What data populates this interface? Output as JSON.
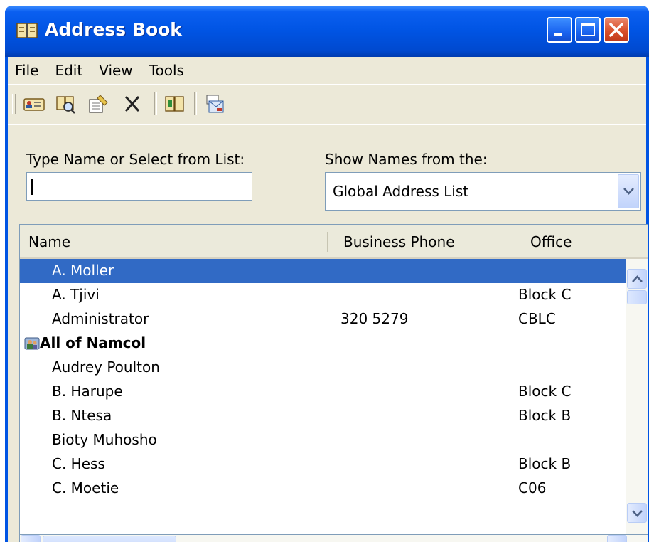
{
  "window": {
    "title": "Address Book",
    "icon": "address-book-icon",
    "controls": {
      "minimize": "minimize-icon",
      "maximize": "maximize-icon",
      "close": "close-icon"
    }
  },
  "menu": [
    "File",
    "Edit",
    "View",
    "Tools"
  ],
  "toolbar": {
    "buttons": [
      "new-entry-icon",
      "find-people-icon",
      "properties-icon",
      "delete-icon",
      "add-to-contacts-icon",
      "new-message-icon"
    ]
  },
  "search": {
    "label": "Type Name or Select from List:",
    "value": ""
  },
  "source": {
    "label": "Show Names from the:",
    "selected": "Global Address List"
  },
  "list": {
    "columns": [
      "Name",
      "Business Phone",
      "Office"
    ],
    "rows": [
      {
        "name": "A. Moller",
        "phone": "",
        "office": "",
        "selected": true
      },
      {
        "name": "A. Tjivi",
        "phone": "",
        "office": "Block C"
      },
      {
        "name": "Administrator",
        "phone": "320 5279",
        "office": "CBLC"
      },
      {
        "name": "All of Namcol",
        "phone": "",
        "office": "",
        "group": true
      },
      {
        "name": "Audrey Poulton",
        "phone": "",
        "office": ""
      },
      {
        "name": "B. Harupe",
        "phone": "",
        "office": "Block C"
      },
      {
        "name": "B. Ntesa",
        "phone": "",
        "office": "Block B"
      },
      {
        "name": "Bioty Muhosho",
        "phone": "",
        "office": ""
      },
      {
        "name": "C. Hess",
        "phone": "",
        "office": "Block B"
      },
      {
        "name": "C. Moetie",
        "phone": "",
        "office": "C06"
      }
    ]
  },
  "colors": {
    "titlebar": "#0054e3",
    "selection": "#316ac5",
    "face": "#ece9d8"
  }
}
